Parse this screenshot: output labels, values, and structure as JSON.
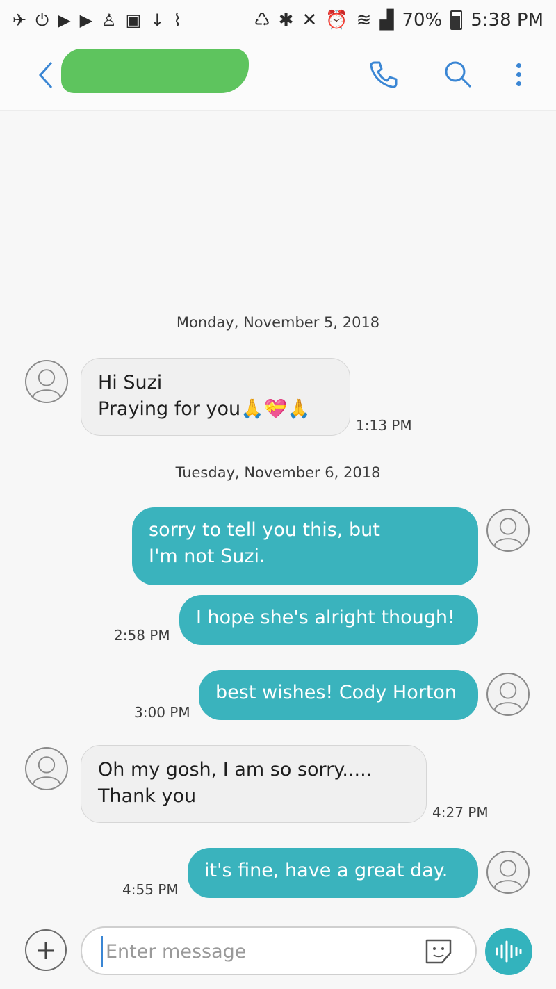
{
  "status_bar": {
    "battery": "70%",
    "time": "5:38 PM"
  },
  "header": {
    "contact_name": "",
    "back_icon": "chevron-left-icon",
    "call_icon": "phone-icon",
    "search_icon": "search-icon",
    "menu_icon": "more-vert-icon"
  },
  "conversation": {
    "date_1": "Monday, November 5, 2018",
    "msg_1": {
      "line1": "Hi Suzi",
      "line2": "Praying for you🙏💝🙏",
      "time": "1:13 PM"
    },
    "date_2": "Tuesday, November 6, 2018",
    "msg_2": {
      "line1": "sorry to tell you this, but",
      "line2": "I'm not Suzi."
    },
    "msg_3": {
      "text": "I hope she's alright though!",
      "time": "2:58 PM"
    },
    "msg_4": {
      "text": "best wishes! Cody Horton",
      "time": "3:00 PM"
    },
    "msg_5": {
      "line1": "Oh my gosh, I am so sorry.....",
      "line2": "Thank you",
      "time": "4:27 PM"
    },
    "msg_6": {
      "text": "it's fine, have a great day.",
      "time": "4:55 PM"
    }
  },
  "composer": {
    "placeholder": "Enter message",
    "attach_icon": "plus-icon",
    "sticker_icon": "sticker-icon",
    "voice_icon": "voice-icon"
  },
  "colors": {
    "accent": "#3a86d4",
    "outgoing_bubble": "#3ab3bd",
    "incoming_bubble": "#f0f0f0",
    "redaction": "#5ec45e"
  }
}
